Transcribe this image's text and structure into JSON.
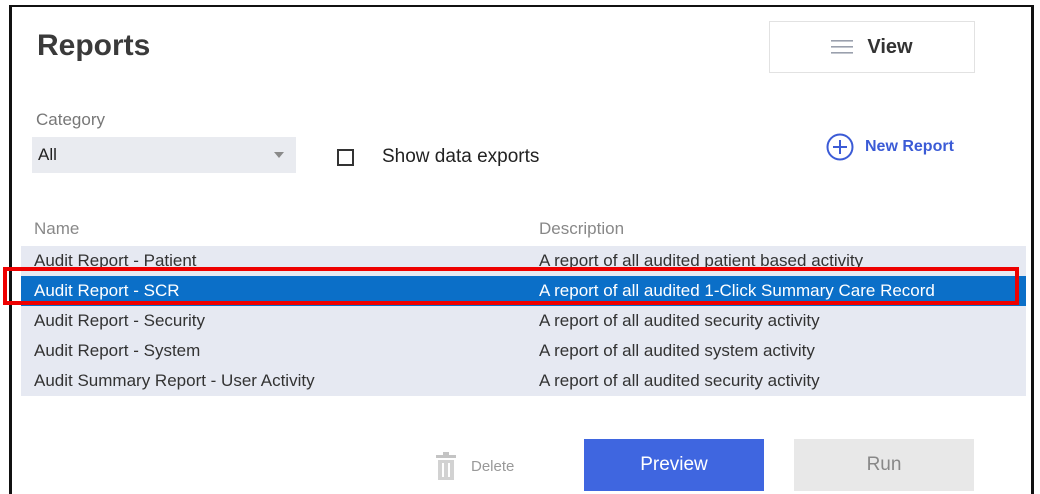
{
  "header": {
    "title": "Reports",
    "view_label": "View",
    "view_icon": "list-icon"
  },
  "filters": {
    "category_label": "Category",
    "category_value": "All",
    "show_exports_label": "Show data exports",
    "show_exports_checked": false,
    "new_report_label": "New Report",
    "new_report_icon": "plus-circle-icon"
  },
  "table": {
    "columns": [
      "Name",
      "Description"
    ],
    "rows": [
      {
        "name": "Audit Report - Patient",
        "description": "A report of all audited patient based activity",
        "selected": false
      },
      {
        "name": "Audit Report - SCR",
        "description": "A report of all audited 1-Click Summary Care Record",
        "selected": true
      },
      {
        "name": "Audit Report - Security",
        "description": "A report of all audited security activity",
        "selected": false
      },
      {
        "name": "Audit Report - System",
        "description": "A report of all audited system activity",
        "selected": false
      },
      {
        "name": "Audit Summary Report - User Activity",
        "description": "A report of all audited security activity",
        "selected": false
      }
    ]
  },
  "actions": {
    "delete_label": "Delete",
    "delete_icon": "trash-icon",
    "preview_label": "Preview",
    "run_label": "Run"
  },
  "colors": {
    "accent": "#3f66e0",
    "selected_row": "#0b6fc8",
    "row_bg": "#e6e9f2",
    "highlight_outline": "#ee0000"
  }
}
